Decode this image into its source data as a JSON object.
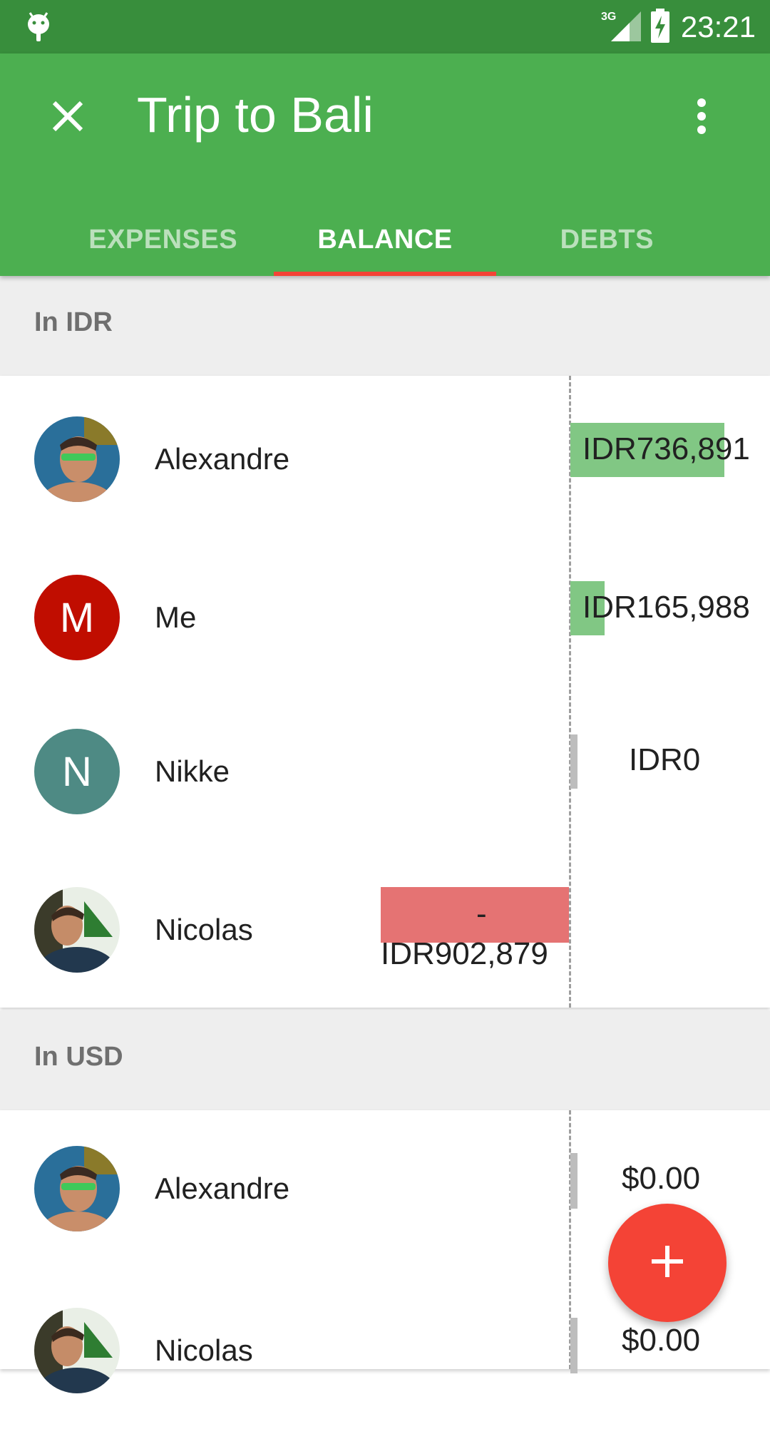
{
  "status_bar": {
    "time": "23:21",
    "network": "3G",
    "icons": [
      "android-icon",
      "signal-icon",
      "battery-charging-icon"
    ]
  },
  "app_bar": {
    "title": "Trip to Bali",
    "close_icon": "close-icon",
    "more_icon": "more-vert-icon"
  },
  "tabs": [
    {
      "label": "EXPENSES",
      "active": false
    },
    {
      "label": "BALANCE",
      "active": true
    },
    {
      "label": "DEBTS",
      "active": false
    }
  ],
  "sections": [
    {
      "header": "In IDR",
      "rows": [
        {
          "name": "Alexandre",
          "avatar": "photo",
          "amount": "IDR736,891",
          "value": 736891
        },
        {
          "name": "Me",
          "avatar": "initial",
          "initial": "M",
          "avatar_color": "#c00d00",
          "amount": "IDR165,988",
          "value": 165988
        },
        {
          "name": "Nikke",
          "avatar": "initial",
          "initial": "N",
          "avatar_color": "#4e8a84",
          "amount": "IDR0",
          "value": 0
        },
        {
          "name": "Nicolas",
          "avatar": "photo",
          "amount_line1": "-",
          "amount_line2": "IDR902,879",
          "value": -902879
        }
      ]
    },
    {
      "header": "In USD",
      "rows": [
        {
          "name": "Alexandre",
          "avatar": "photo",
          "amount": "$0.00",
          "value": 0
        },
        {
          "name": "Nicolas",
          "avatar": "photo",
          "amount": "$0.00",
          "value": 0
        }
      ]
    }
  ],
  "colors": {
    "primary": "#4caf50",
    "primary_dark": "#388e3c",
    "accent": "#f44336",
    "positive_bar": "#81c784",
    "negative_bar": "#e57373",
    "zero_bar": "#bdbdbd"
  },
  "fab": {
    "icon": "add-icon"
  }
}
